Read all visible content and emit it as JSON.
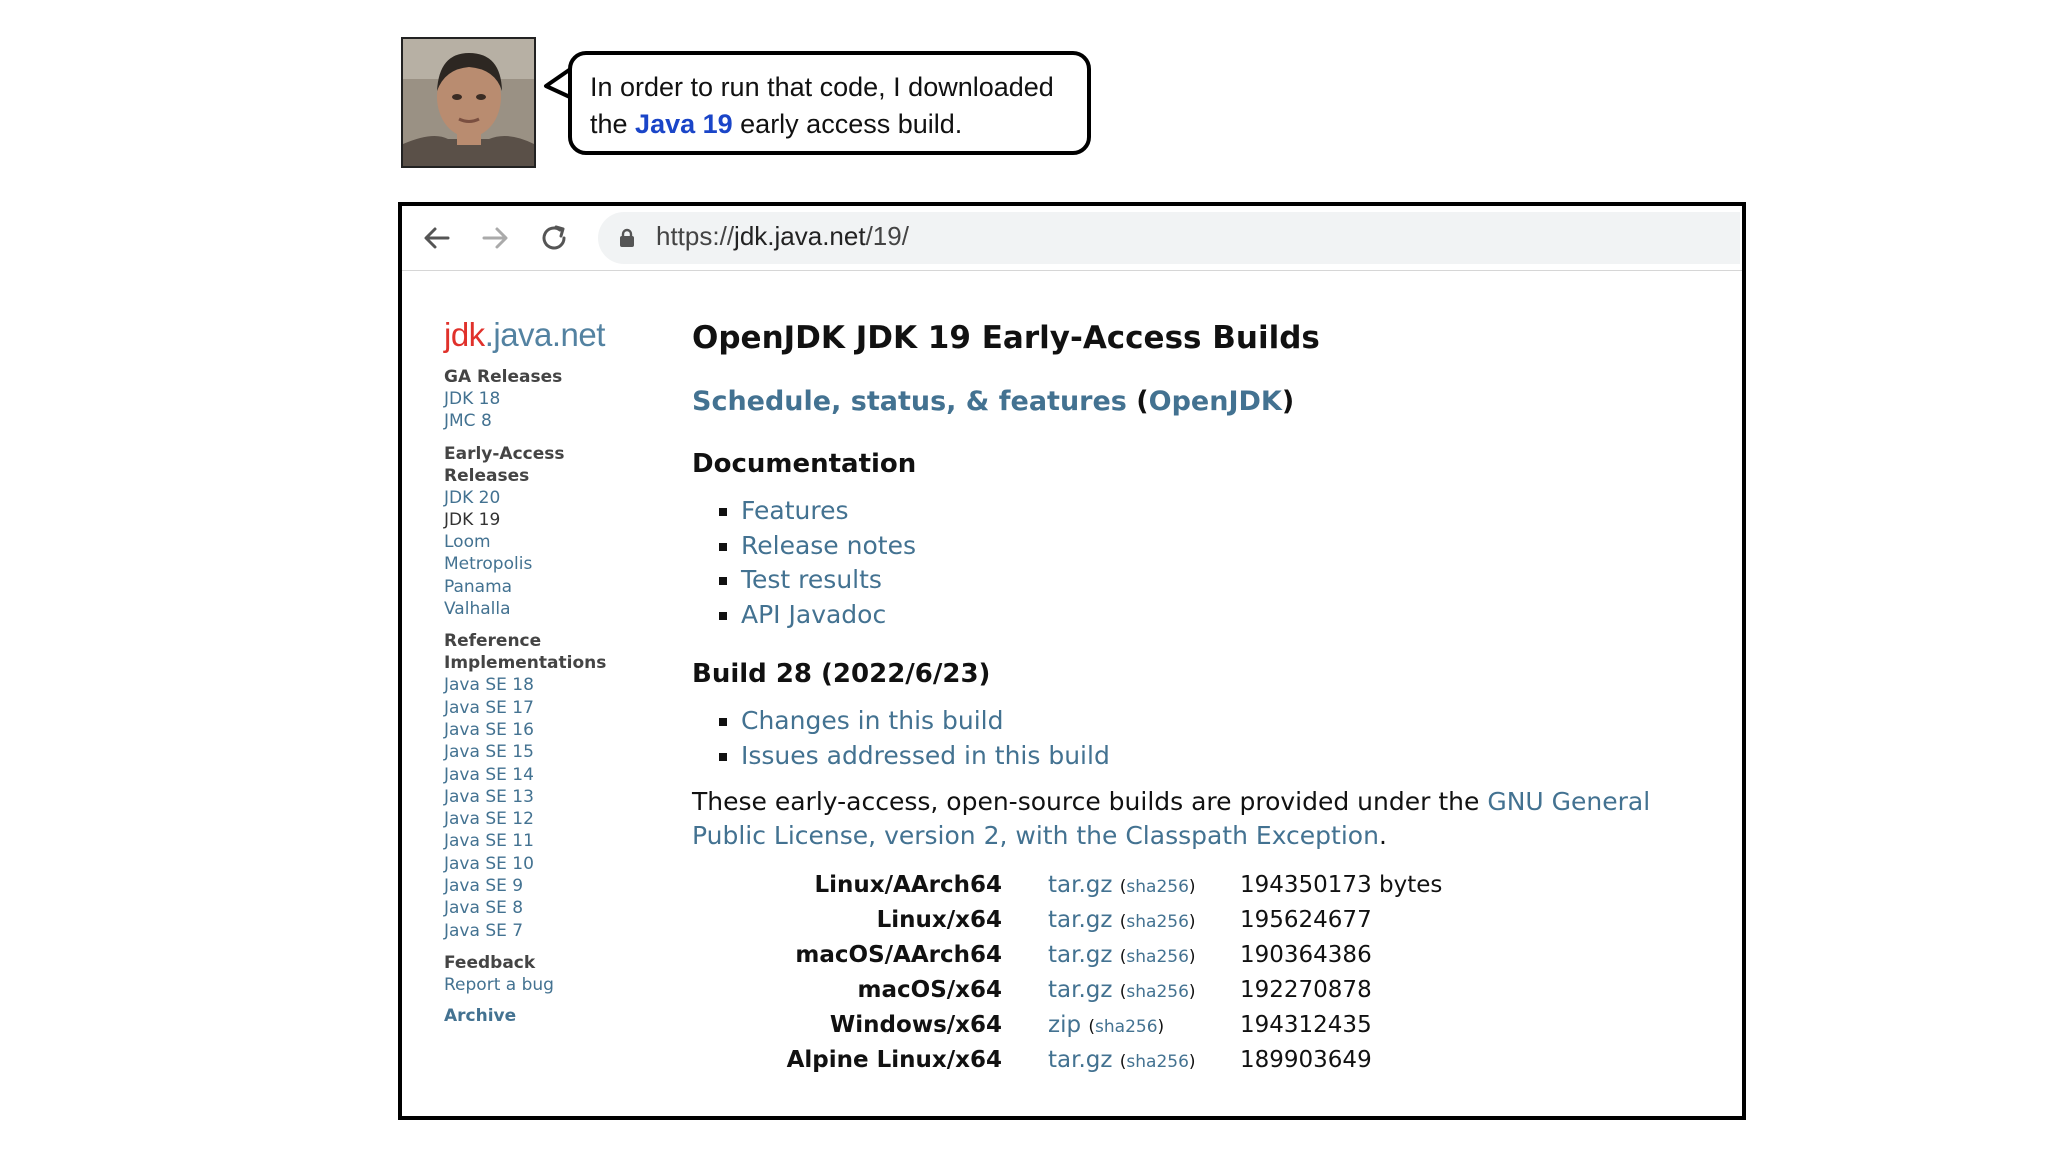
{
  "speech": {
    "line1": "In order to run that code, I downloaded",
    "line2_before": "the ",
    "line2_highlight": "Java 19",
    "line2_after": " early access build."
  },
  "browser": {
    "url_scheme": "https://",
    "url_host": "jdk.java.net",
    "url_path": "/19/",
    "icons": [
      "back-arrow-icon",
      "forward-arrow-icon",
      "reload-icon",
      "lock-icon"
    ]
  },
  "sidebar": {
    "logo_jdk": "jdk",
    "logo_rest": ".java.net",
    "ga_heading": "GA Releases",
    "ga_items": [
      "JDK 18",
      "JMC 8"
    ],
    "ea_heading_1": "Early-Access",
    "ea_heading_2": "Releases",
    "ea_items": [
      "JDK 20",
      "JDK 19",
      "Loom",
      "Metropolis",
      "Panama",
      "Valhalla"
    ],
    "ref_heading_1": "Reference",
    "ref_heading_2": "Implementations",
    "ref_items": [
      "Java SE 18",
      "Java SE 17",
      "Java SE 16",
      "Java SE 15",
      "Java SE 14",
      "Java SE 13",
      "Java SE 12",
      "Java SE 11",
      "Java SE 10",
      "Java SE 9",
      "Java SE 8",
      "Java SE 7"
    ],
    "feedback_heading": "Feedback",
    "feedback_item": "Report a bug",
    "archive": "Archive"
  },
  "main": {
    "title": "OpenJDK JDK 19 Early-Access Builds",
    "schedule_link": "Schedule, status, & features",
    "schedule_open": " (",
    "schedule_openjdk": "OpenJDK",
    "schedule_close": ")",
    "doc_heading": "Documentation",
    "doc_links": [
      "Features",
      "Release notes",
      "Test results",
      "API Javadoc"
    ],
    "build_heading": "Build 28 (2022/6/23)",
    "build_links": [
      "Changes in this build",
      "Issues addressed in this build"
    ],
    "license_text": "These early-access, open-source builds are provided under the ",
    "license_link": "GNU General Public License, version 2, with the Classpath Exception",
    "license_end": ".",
    "downloads": [
      {
        "platform": "Linux/AArch64",
        "file": "tar.gz",
        "sha": "sha256",
        "size": "194350173 bytes"
      },
      {
        "platform": "Linux/x64",
        "file": "tar.gz",
        "sha": "sha256",
        "size": "195624677"
      },
      {
        "platform": "macOS/AArch64",
        "file": "tar.gz",
        "sha": "sha256",
        "size": "190364386"
      },
      {
        "platform": "macOS/x64",
        "file": "tar.gz",
        "sha": "sha256",
        "size": "192270878"
      },
      {
        "platform": "Windows/x64",
        "file": "zip",
        "sha": "sha256",
        "size": "194312435"
      },
      {
        "platform": "Alpine Linux/x64",
        "file": "tar.gz",
        "sha": "sha256",
        "size": "189903649"
      }
    ]
  }
}
